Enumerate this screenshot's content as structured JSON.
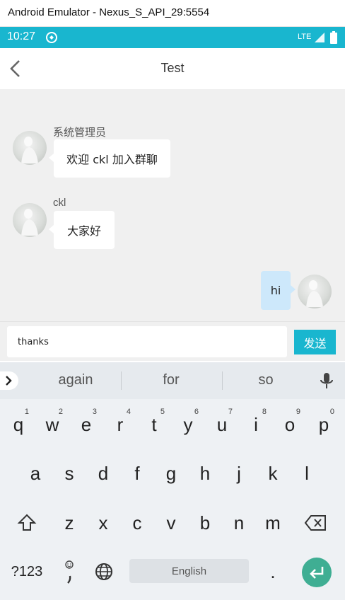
{
  "window": {
    "title": "Android Emulator - Nexus_S_API_29:5554"
  },
  "status_bar": {
    "time": "10:27",
    "network": "LTE",
    "accent_color": "#19b6cf"
  },
  "toolbar": {
    "title": "Test",
    "back_icon": "chevron-left-icon"
  },
  "messages": [
    {
      "sender": "系统管理员",
      "text": "欢迎 ckl 加入群聊",
      "side": "left"
    },
    {
      "sender": "ckl",
      "text": "大家好",
      "side": "left"
    },
    {
      "sender": "",
      "text": "hi",
      "side": "right"
    }
  ],
  "composer": {
    "value": "thanks",
    "send_label": "发送"
  },
  "keyboard": {
    "suggestions": [
      "again",
      "for",
      "so"
    ],
    "row1": [
      {
        "key": "q",
        "hint": "1"
      },
      {
        "key": "w",
        "hint": "2"
      },
      {
        "key": "e",
        "hint": "3"
      },
      {
        "key": "r",
        "hint": "4"
      },
      {
        "key": "t",
        "hint": "5"
      },
      {
        "key": "y",
        "hint": "6"
      },
      {
        "key": "u",
        "hint": "7"
      },
      {
        "key": "i",
        "hint": "8"
      },
      {
        "key": "o",
        "hint": "9"
      },
      {
        "key": "p",
        "hint": "0"
      }
    ],
    "row2": [
      "a",
      "s",
      "d",
      "f",
      "g",
      "h",
      "j",
      "k",
      "l"
    ],
    "row3": [
      "z",
      "x",
      "c",
      "v",
      "b",
      "n",
      "m"
    ],
    "symbols_label": "?123",
    "space_label": "English",
    "period": "."
  },
  "colors": {
    "send_button": "#19b6cf",
    "outgoing_bubble": "#cde8fb",
    "enter_key": "#3fae93"
  }
}
